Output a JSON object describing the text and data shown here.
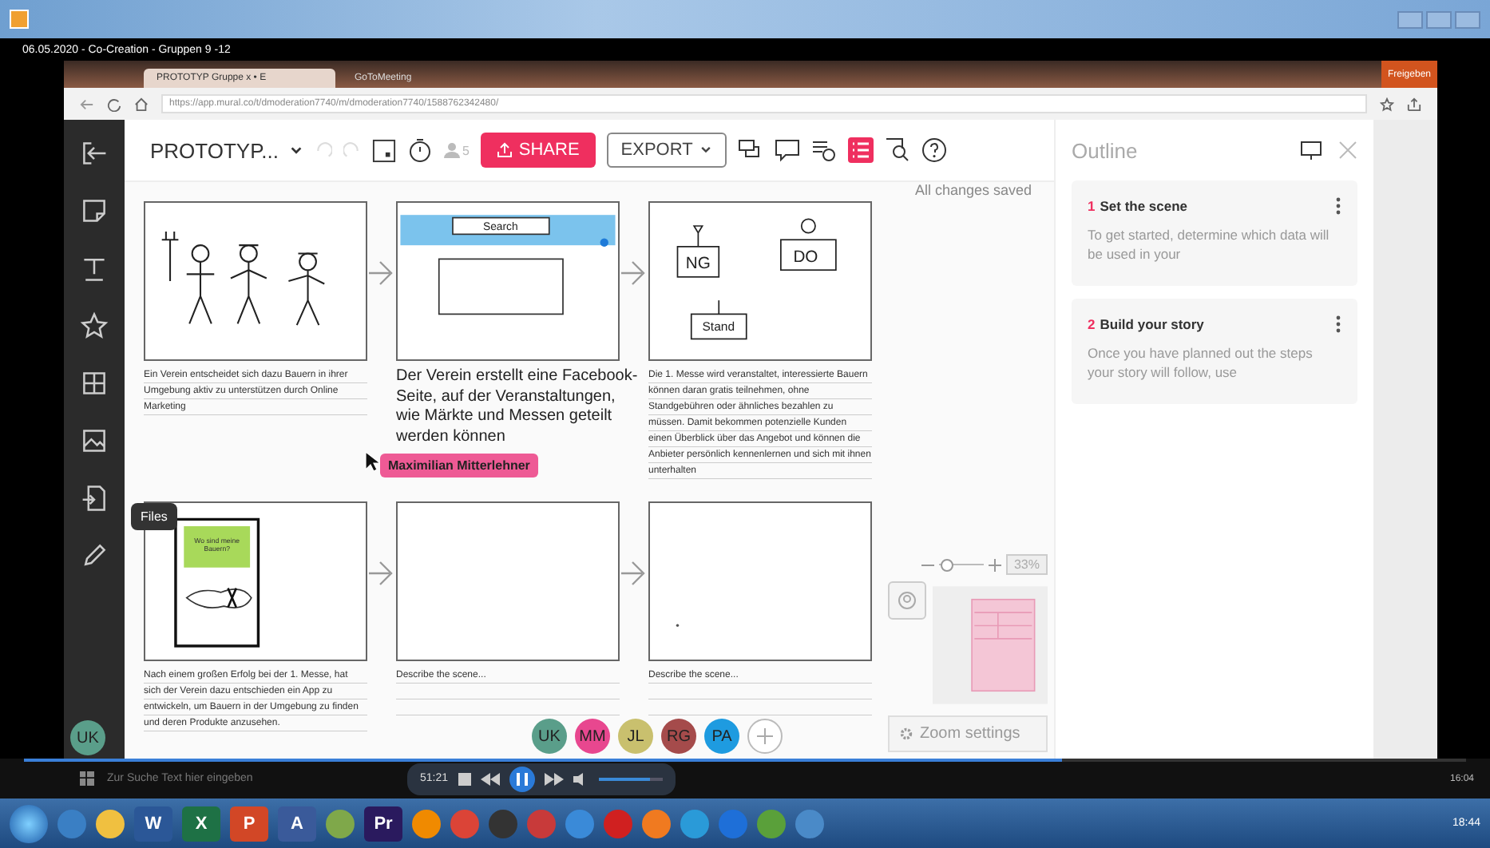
{
  "recording_title": "06.05.2020 - Co-Creation - Gruppen 9 -12",
  "browser": {
    "tabs": [
      {
        "label": "PROTOTYP Gruppe x • E",
        "selected": true
      },
      {
        "label": "GoToMeeting",
        "selected": false
      }
    ],
    "url": "https://app.mural.co/t/dmoderation7740/m/dmoderation7740/1588762342480/",
    "share_button": "Freigeben"
  },
  "mural": {
    "board_title": "PROTOTYP...",
    "participants_count": "5",
    "share": "SHARE",
    "export": "EXPORT",
    "save_status": "All changes saved",
    "sidebar_tooltip": "Files",
    "frames": [
      {
        "kind": "farmers",
        "caption": "Ein Verein entscheidet sich dazu Bauern in ihrer Umgebung aktiv zu unterstützen durch Online Marketing",
        "large_caption": false
      },
      {
        "kind": "website",
        "labels": [
          "Search"
        ],
        "caption": "Der Verein erstellt eine Facebook-Seite, auf der Veranstaltungen, wie Märkte und Messen geteilt werden können",
        "large_caption": true
      },
      {
        "kind": "booths",
        "labels": [
          "NG",
          "DO",
          "Stand"
        ],
        "caption": "Die 1. Messe wird veranstaltet, interessierte Bauern können daran gratis teilnehmen, ohne Standgebühren oder ähnliches bezahlen zu müssen. Damit bekommen potenzielle Kunden einen Überblick über das Angebot und können die Anbieter persönlich kennenlernen und sich mit ihnen unterhalten",
        "large_caption": false
      },
      {
        "kind": "phone",
        "labels": [
          "Wo sind meine Bauern?"
        ],
        "caption": "Nach einem großen Erfolg bei der 1. Messe, hat sich der Verein dazu entschieden ein App zu entwickeln, um Bauern in der Umgebung zu finden und deren Produkte anzusehen.",
        "large_caption": false
      },
      {
        "kind": "blank",
        "caption": "Describe the scene...",
        "large_caption": false
      },
      {
        "kind": "blank",
        "caption": "Describe the scene...",
        "large_caption": false
      }
    ],
    "cursor_label": "Maximilian Mitterlehner",
    "zoom": {
      "level": 0.15,
      "percent": "33%",
      "settings": "Zoom settings"
    },
    "collaborators": [
      {
        "initials": "UK",
        "color": "#5a9e8a"
      },
      {
        "initials": "MM",
        "color": "#e8478f"
      },
      {
        "initials": "JL",
        "color": "#c9c06e"
      },
      {
        "initials": "RG",
        "color": "#a54b4b"
      },
      {
        "initials": "PA",
        "color": "#1e9be0"
      }
    ],
    "current_user": "UK",
    "outline": {
      "title": "Outline",
      "steps": [
        {
          "number": "1",
          "title": "Set the scene",
          "text": "To get started, determine which data will be used in your"
        },
        {
          "number": "2",
          "title": "Build your story",
          "text": "Once you have planned out the steps your story will follow, use"
        }
      ]
    }
  },
  "player": {
    "time": "51:21",
    "progress": {
      "level": 0.72
    },
    "volume": {
      "level": 0.8
    }
  },
  "inner_taskbar": {
    "search_placeholder": "Zur Suche Text hier eingeben",
    "clock": "16:04"
  },
  "taskbar": {
    "apps": [
      {
        "kind": "round",
        "color": "#3a7fc4"
      },
      {
        "kind": "round",
        "color": "#f0c040"
      },
      {
        "kind": "letter",
        "label": "W",
        "color": "#2b5797"
      },
      {
        "kind": "letter",
        "label": "X",
        "color": "#1e7145"
      },
      {
        "kind": "letter",
        "label": "P",
        "color": "#d24726"
      },
      {
        "kind": "letter",
        "label": "A",
        "color": "#3a5a9a"
      },
      {
        "kind": "round",
        "color": "#7fa84a"
      },
      {
        "kind": "letter",
        "label": "Pr",
        "color": "#2a1a5e"
      },
      {
        "kind": "round",
        "color": "#f08a00"
      },
      {
        "kind": "round",
        "color": "#db4437"
      },
      {
        "kind": "round",
        "color": "#333333"
      },
      {
        "kind": "round",
        "color": "#c83a3a"
      },
      {
        "kind": "round",
        "color": "#3a8ad8"
      },
      {
        "kind": "round",
        "color": "#d02020"
      },
      {
        "kind": "round",
        "color": "#f07a20"
      },
      {
        "kind": "round",
        "color": "#2a9ad8"
      },
      {
        "kind": "round",
        "color": "#1e6fd8"
      },
      {
        "kind": "round",
        "color": "#5aa03a"
      },
      {
        "kind": "round",
        "color": "#4a8ac8"
      }
    ],
    "clock": "18:44"
  }
}
